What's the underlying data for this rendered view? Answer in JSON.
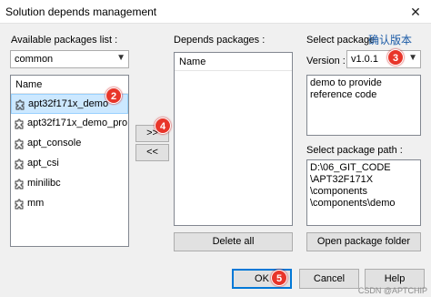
{
  "window": {
    "title": "Solution depends management",
    "close_glyph": "✕"
  },
  "left": {
    "label": "Available packages list :",
    "filter_value": "common",
    "column_header": "Name",
    "items": [
      "apt32f171x_demo",
      "apt32f171x_demo_pro",
      "apt_console",
      "apt_csi",
      "minilibc",
      "mm"
    ],
    "selected_index": 0
  },
  "move": {
    "add_label": ">>",
    "remove_label": "<<"
  },
  "middle": {
    "label": "Depends packages :",
    "column_header": "Name",
    "delete_all_label": "Delete all"
  },
  "right": {
    "label": "Select package",
    "chinese_note": "确认版本",
    "version_label": "Version :",
    "version_value": "v1.0.1",
    "description_lines": [
      "demo to provide",
      "reference code"
    ],
    "path_label": "Select package path :",
    "path_lines": [
      "D:\\06_GIT_CODE",
      "\\APT32F171X",
      "\\components",
      "\\components\\demo"
    ],
    "open_folder_label": "Open package folder"
  },
  "footer": {
    "ok_label": "OK",
    "cancel_label": "Cancel",
    "help_label": "Help"
  },
  "badges": [
    "2",
    "3",
    "4",
    "5"
  ],
  "watermark": "CSDN @APTCHIP",
  "colors": {
    "badge": "#e8352a",
    "selection": "#cce8ff",
    "focus_border": "#0078d7",
    "chinese_text": "#1a5aa6"
  }
}
